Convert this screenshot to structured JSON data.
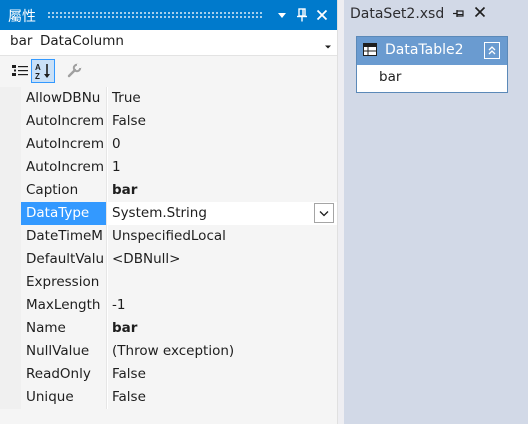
{
  "properties_panel": {
    "title": "屬性",
    "object_selector": {
      "name": "bar",
      "type": "DataColumn"
    },
    "rows": [
      {
        "name": "AllowDBNu",
        "value": "True",
        "bold": false
      },
      {
        "name": "AutoIncrem",
        "value": "False",
        "bold": false
      },
      {
        "name": "AutoIncrem",
        "value": "0",
        "bold": false
      },
      {
        "name": "AutoIncrem",
        "value": "1",
        "bold": false
      },
      {
        "name": "Caption",
        "value": "bar",
        "bold": true
      },
      {
        "name": "DataType",
        "value": "System.String",
        "bold": false,
        "selected": true
      },
      {
        "name": "DateTimeM",
        "value": "UnspecifiedLocal",
        "bold": false
      },
      {
        "name": "DefaultValu",
        "value": "<DBNull>",
        "bold": false
      },
      {
        "name": "Expression",
        "value": "",
        "bold": false
      },
      {
        "name": "MaxLength",
        "value": "-1",
        "bold": false
      },
      {
        "name": "Name",
        "value": "bar",
        "bold": true
      },
      {
        "name": "NullValue",
        "value": "(Throw exception)",
        "bold": false
      },
      {
        "name": "ReadOnly",
        "value": "False",
        "bold": false
      },
      {
        "name": "Unique",
        "value": "False",
        "bold": false
      }
    ]
  },
  "document_tab": {
    "title": "DataSet2.xsd"
  },
  "data_table": {
    "title": "DataTable2",
    "columns": [
      "bar"
    ]
  },
  "colors": {
    "title_bar": "#007acc",
    "selection": "#3399ff",
    "table_header": "#6a9bd0",
    "designer_bg": "#d2d9e7"
  }
}
